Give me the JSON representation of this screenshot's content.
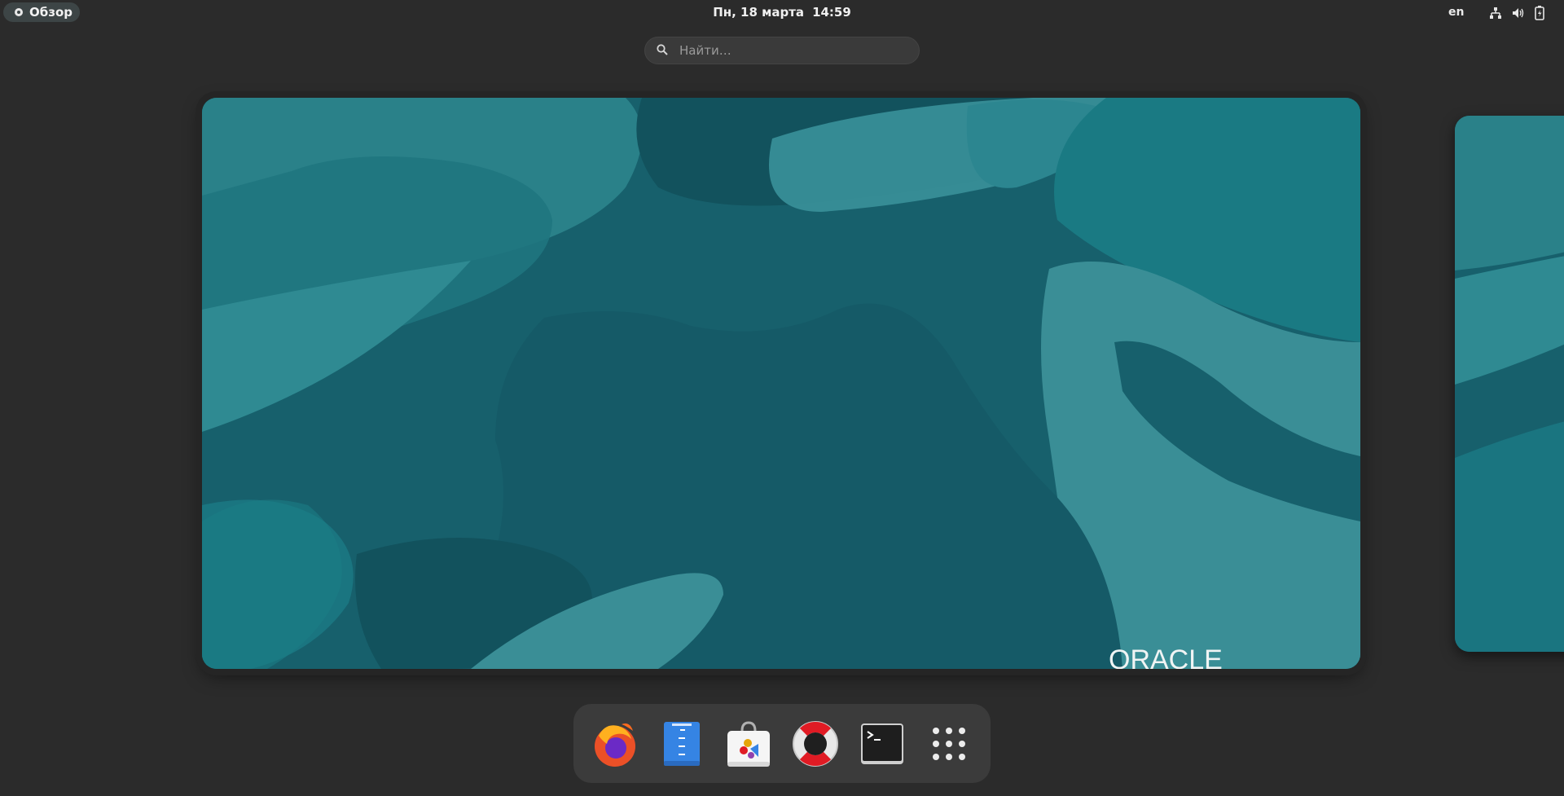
{
  "topbar": {
    "activities_label": "Обзор",
    "date": "Пн, 18 марта",
    "time": "14:59",
    "language": "en",
    "tray_icons": [
      "network-icon",
      "volume-icon",
      "battery-icon"
    ]
  },
  "search": {
    "placeholder": "Найти…"
  },
  "workspace": {
    "wallpaper_logo": "ORACLE"
  },
  "dock": {
    "items": [
      {
        "name": "firefox",
        "icon": "firefox-icon"
      },
      {
        "name": "text-editor",
        "icon": "text-editor-icon"
      },
      {
        "name": "software",
        "icon": "software-center-icon"
      },
      {
        "name": "help",
        "icon": "help-lifebuoy-icon"
      },
      {
        "name": "terminal",
        "icon": "terminal-icon"
      },
      {
        "name": "show-apps",
        "icon": "app-grid-icon"
      }
    ]
  },
  "colors": {
    "background": "#2b2b2b",
    "wallpaper_teal": "#1b6f78",
    "dock_bg": "#3b3b3b"
  }
}
